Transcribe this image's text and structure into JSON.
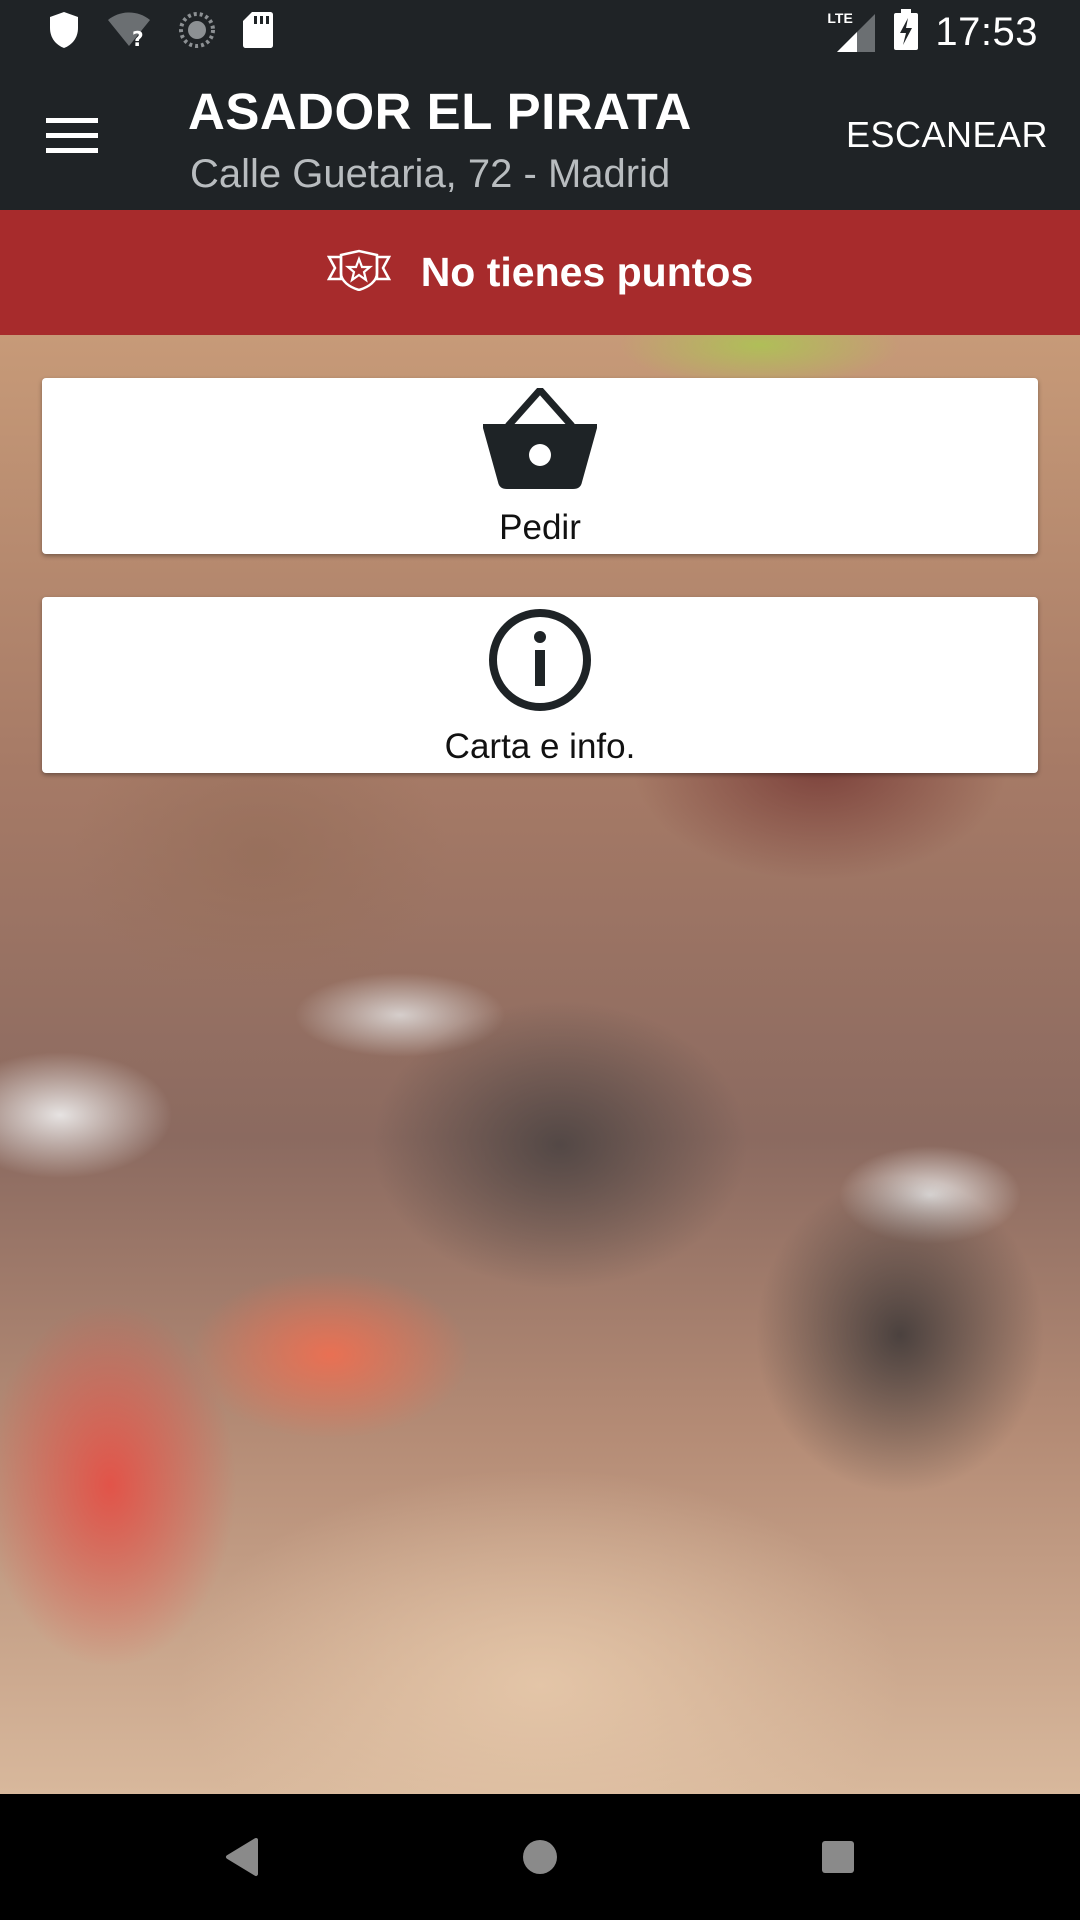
{
  "status_bar": {
    "time": "17:53",
    "network_label": "LTE",
    "icons": [
      "shield-icon",
      "wifi-unknown-icon",
      "loading-icon",
      "sd-card-icon",
      "lte-signal-icon",
      "battery-charging-icon"
    ]
  },
  "app_bar": {
    "title": "ASADOR EL PIRATA",
    "subtitle": "Calle Guetaria, 72 - Madrid",
    "action_label": "ESCANEAR",
    "menu_icon": "menu-icon"
  },
  "points_banner": {
    "text": "No tienes puntos",
    "icon": "badge-star-icon",
    "background_color": "#a72b2c"
  },
  "cards": {
    "order": {
      "label": "Pedir",
      "icon": "basket-icon"
    },
    "info": {
      "label": "Carta e info.",
      "icon": "info-icon"
    }
  },
  "nav_bar": {
    "icons": [
      "back-icon",
      "home-icon",
      "recents-icon"
    ]
  },
  "colors": {
    "app_bar": "#1f2326",
    "accent": "#a72b2c",
    "card": "#ffffff"
  }
}
